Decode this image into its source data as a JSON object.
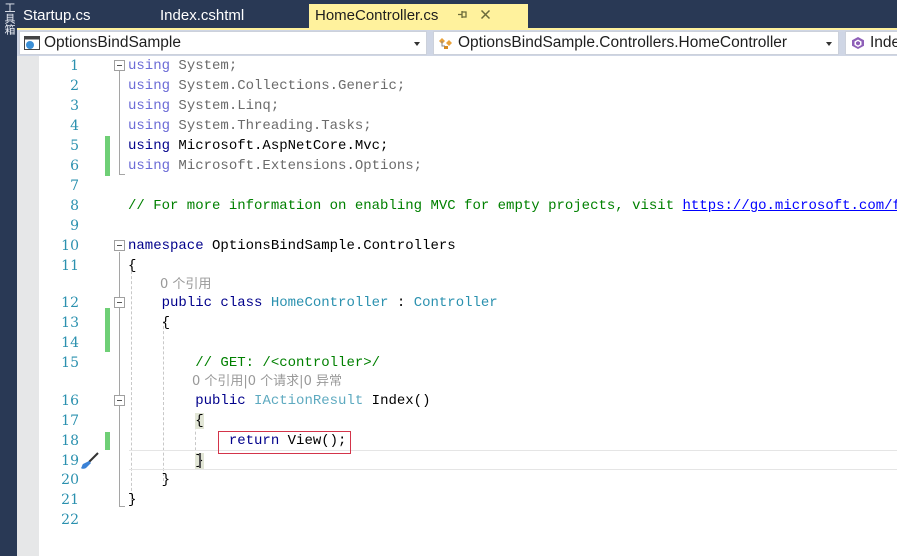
{
  "side_panel": {
    "label": "工具箱"
  },
  "tabs": [
    {
      "label": "Startup.cs",
      "active": false
    },
    {
      "label": "Index.cshtml",
      "active": false
    },
    {
      "label": "HomeController.cs",
      "active": true,
      "pin_icon": "⊣",
      "close_icon": "✕"
    }
  ],
  "nav": {
    "project": "OptionsBindSample",
    "type": "OptionsBindSample.Controllers.HomeController",
    "member": "Inde"
  },
  "colors": {
    "active_tab": "#fff29d",
    "chrome": "#293955",
    "change_marker": "#6fcf76",
    "highlight_box": "#d3344a"
  },
  "code": {
    "line_numbers": [
      "1",
      "2",
      "3",
      "4",
      "5",
      "6",
      "7",
      "8",
      "9",
      "10",
      "11",
      "12",
      "13",
      "14",
      "15",
      "16",
      "17",
      "18",
      "19",
      "20",
      "21",
      "22"
    ],
    "l1": {
      "kw": "using",
      "rest": " System;"
    },
    "l2": {
      "kw": "using",
      "rest": " System.Collections.Generic;"
    },
    "l3": {
      "kw": "using",
      "rest": " System.Linq;"
    },
    "l4": {
      "kw": "using",
      "rest": " System.Threading.Tasks;"
    },
    "l5": {
      "kw": "using",
      "rest": " Microsoft.AspNetCore.Mvc;"
    },
    "l6": {
      "kw": "using",
      "rest": " Microsoft.Extensions.Options;"
    },
    "l8": {
      "comment": "// For more information on enabling MVC for empty projects, visit ",
      "link": "https://go.microsoft.com/fwlink/"
    },
    "l10": {
      "kw": "namespace",
      "rest": " OptionsBindSample.Controllers"
    },
    "l11": {
      "brace": "{"
    },
    "lens_class": "0 个引用",
    "l12": {
      "kw": "public class",
      "type": "HomeController",
      "sep": " : ",
      "base": "Controller"
    },
    "l13": {
      "brace": "{"
    },
    "l15": {
      "comment": "// GET: /<controller>/"
    },
    "lens_method": "0 个引用|0 个请求|0 异常",
    "l16": {
      "kw": "public",
      "type": "IActionResult",
      "rest": " Index()"
    },
    "l17": {
      "brace": "{"
    },
    "l18": {
      "kw": "return",
      "rest": " View();"
    },
    "l19": {
      "brace": "}"
    },
    "l20": {
      "brace": "}"
    },
    "l21": {
      "brace": "}"
    }
  }
}
